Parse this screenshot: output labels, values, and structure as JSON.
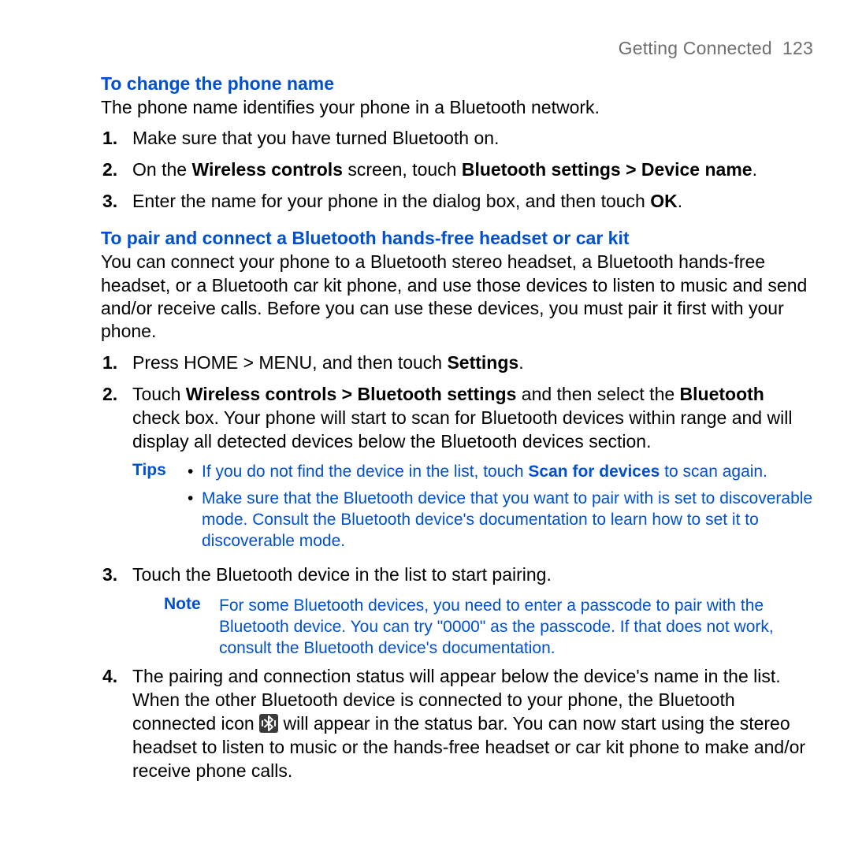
{
  "header": {
    "chapter": "Getting Connected",
    "page_number": "123"
  },
  "section1": {
    "heading": "To change the phone name",
    "intro": "The phone name identifies your phone in a Bluetooth network.",
    "steps": [
      {
        "num": "1.",
        "pre": "Make sure that you have turned Bluetooth on."
      },
      {
        "num": "2.",
        "pre": "On the ",
        "b1": "Wireless controls",
        "mid1": " screen, touch ",
        "b2": "Bluetooth settings > Device name",
        "post": "."
      },
      {
        "num": "3.",
        "pre": "Enter the name for your phone in the dialog box, and then touch ",
        "b1": "OK",
        "post": "."
      }
    ]
  },
  "section2": {
    "heading": "To pair and connect a Bluetooth hands-free headset or car kit",
    "intro": "You can connect your phone to a Bluetooth stereo headset, a Bluetooth hands-free headset, or a Bluetooth car kit phone, and use those devices to listen to music and send and/or receive calls. Before you can use these devices, you must pair it first with your phone.",
    "steps12": [
      {
        "num": "1.",
        "pre": "Press HOME > MENU, and then touch ",
        "b1": "Settings",
        "post": "."
      },
      {
        "num": "2.",
        "pre": "Touch ",
        "b1": "Wireless controls > Bluetooth settings",
        "mid1": " and then select the ",
        "b2": "Bluetooth",
        "post": " check box. Your phone will start to scan for Bluetooth devices within range and will display all detected devices below the Bluetooth devices section."
      }
    ],
    "tips_label": "Tips",
    "tips": [
      {
        "pre": "If you do not find the device in the list, touch ",
        "b1": "Scan for devices",
        "post": " to scan again."
      },
      {
        "pre": "Make sure that the Bluetooth device that you want to pair with is set to discoverable mode. Consult the Bluetooth device's documentation to learn how to set it to discoverable mode."
      }
    ],
    "step3": {
      "num": "3.",
      "pre": "Touch the Bluetooth device in the list to start pairing."
    },
    "note_label": "Note",
    "note_body": "For some Bluetooth devices, you need to enter a passcode to pair with the Bluetooth device. You can try \"0000\" as the passcode. If that does not work, consult the Bluetooth device's documentation.",
    "step4": {
      "num": "4.",
      "pre": "The pairing and connection status will appear below the device's name in the list. When the other Bluetooth device is connected to your phone, the Bluetooth connected icon ",
      "post": " will appear in the status bar. You can now start using the stereo headset to listen to music or the hands-free headset or car kit phone to make and/or receive phone calls."
    }
  }
}
